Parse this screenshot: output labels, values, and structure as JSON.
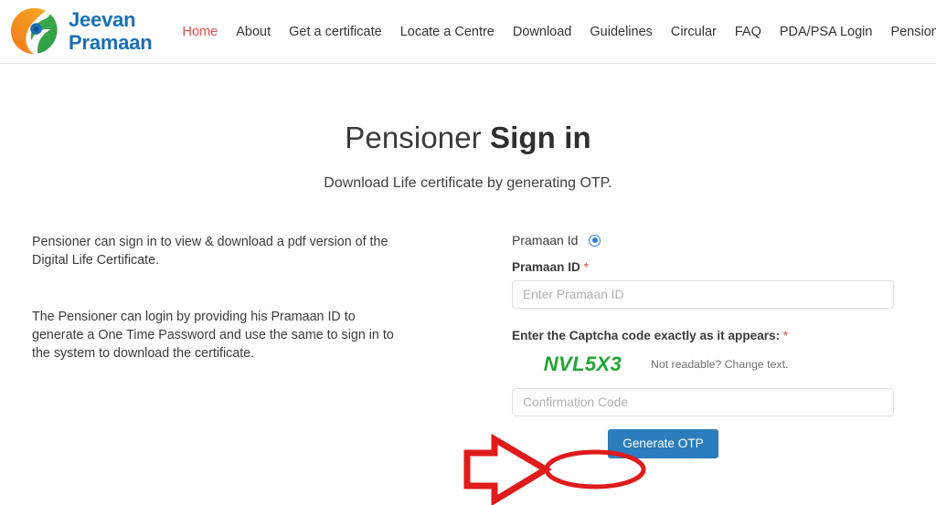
{
  "header": {
    "logo_icon": "jeevan-pramaan-emblem-icon",
    "brand_line1": "Jeevan",
    "brand_line2": "Pramaan",
    "brand_color": "#1a6fb5",
    "nav": [
      {
        "label": "Home",
        "active": true
      },
      {
        "label": "About",
        "active": false
      },
      {
        "label": "Get a certificate",
        "active": false
      },
      {
        "label": "Locate a Centre",
        "active": false
      },
      {
        "label": "Download",
        "active": false
      },
      {
        "label": "Guidelines",
        "active": false
      },
      {
        "label": "Circular",
        "active": false
      },
      {
        "label": "FAQ",
        "active": false
      },
      {
        "label": "PDA/PSA Login",
        "active": false
      },
      {
        "label": "Pensioner Login",
        "active": false
      }
    ],
    "active_color": "#d9534f"
  },
  "page": {
    "title_light": "Pensioner ",
    "title_bold": "Sign in",
    "subtitle": "Download Life certificate by generating OTP."
  },
  "info": {
    "paragraph1": "Pensioner can sign in to view & download a pdf version of the Digital Life Certificate.",
    "paragraph2": "The Pensioner can login by providing his Pramaan ID to generate a One Time Password and use the same to sign in to the system to download the certificate."
  },
  "form": {
    "radio_label": "Pramaan Id",
    "radio_selected": true,
    "radio_color": "#2f7fd4",
    "pramaan_id_label": "Pramaan ID",
    "required_mark": "*",
    "pramaan_id_value": "",
    "pramaan_id_placeholder": "Enter Pramaan ID",
    "captcha_label": "Enter the Captcha code exactly as it appears:",
    "captcha_text": "NVL5X3",
    "captcha_color": "#22a534",
    "captcha_change_link": "Not readable? Change text.",
    "confirmation_value": "",
    "confirmation_placeholder": "Confirmation Code",
    "submit_label": "Generate OTP",
    "submit_color": "#2b7dbd"
  },
  "annotation": {
    "arrow_icon": "red-block-arrow-right-icon",
    "highlight_icon": "red-ellipse-highlight-icon",
    "color": "#e01b1b"
  }
}
